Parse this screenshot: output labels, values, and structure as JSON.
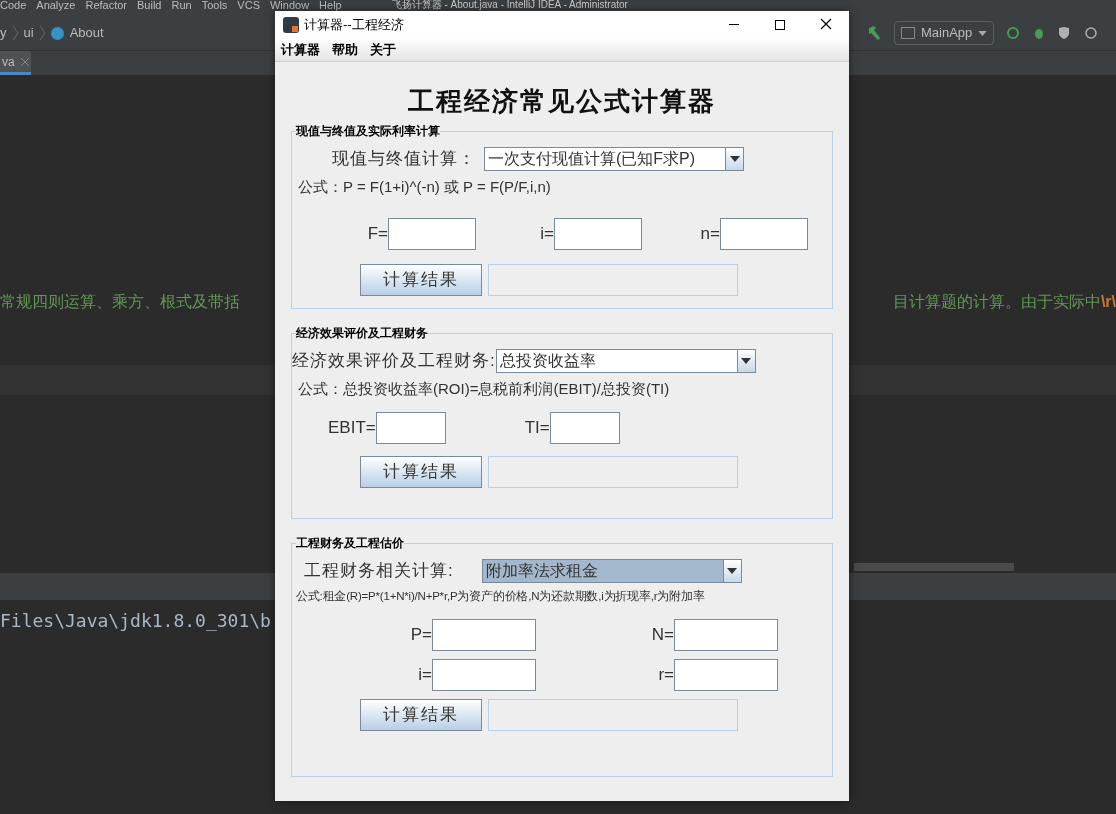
{
  "ide": {
    "menu": [
      "Code",
      "Analyze",
      "Refactor",
      "Build",
      "Run",
      "Tools",
      "VCS",
      "Window",
      "Help"
    ],
    "title": "飞扬计算器 - About.java - IntelliJ IDEA - Administrator",
    "breadcrumbs": [
      "y",
      "ui",
      "About"
    ],
    "editor_tab": "va",
    "run_config": "MainApp",
    "code_left": "常规四则运算、乘方、根式及带括",
    "code_right": "目计算题的计算。由于实际中",
    "code_right_escape": "\\r\\",
    "console_line": "Files\\Java\\jdk1.8.0_301\\b"
  },
  "dialog": {
    "title": "计算器--工程经济",
    "menu": [
      "计算器",
      "帮助",
      "关于"
    ],
    "heading": "工程经济常见公式计算器",
    "sections": [
      {
        "title": "现值与终值及实际利率计算",
        "combo_label": "现值与终值计算：",
        "combo_value": "一次支付现值计算(已知F求P)",
        "focused": false,
        "formula": "公式：P = F(1+i)^(-n) 或 P = F(P/F,i,n)",
        "field_rows": [
          [
            "F=",
            "i=",
            "n="
          ]
        ],
        "button": "计算结果"
      },
      {
        "title": "经济效果评价及工程财务",
        "combo_label": "经济效果评价及工程财务:",
        "combo_value": "总投资收益率",
        "focused": false,
        "formula": "公式：总投资收益率(ROI)=息税前利润(EBIT)/总投资(TI)",
        "field_rows": [
          [
            "EBIT=",
            "TI="
          ]
        ],
        "button": "计算结果"
      },
      {
        "title": "工程财务及工程估价",
        "combo_label": "工程财务相关计算:",
        "combo_value": "附加率法求租金",
        "focused": true,
        "formula": "公式:租金(R)=P*(1+N*i)/N+P*r,P为资产的价格,N为还款期数,i为折现率,r为附加率",
        "field_rows": [
          [
            "P=",
            "N="
          ],
          [
            "i=",
            "r="
          ]
        ],
        "button": "计算结果"
      }
    ]
  }
}
